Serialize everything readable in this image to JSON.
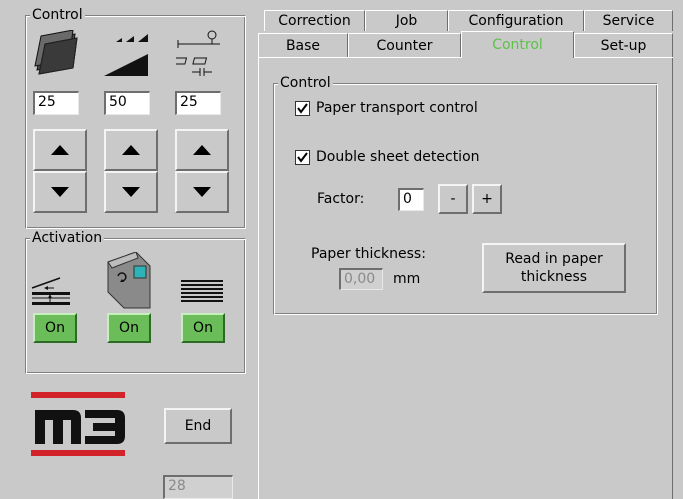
{
  "left_panel": {
    "control_group": {
      "title": "Control",
      "values": [
        "25",
        "50",
        "25"
      ]
    },
    "activation_group": {
      "title": "Activation",
      "buttons": [
        "On",
        "On",
        "On"
      ]
    },
    "logo_text": "M3",
    "end_button": "End",
    "counter_value": "28"
  },
  "tabs": {
    "row_back": [
      "Correction",
      "Job",
      "Configuration",
      "Service"
    ],
    "row_front": [
      "Base",
      "Counter",
      "Control",
      "Set-up"
    ],
    "active": "Control",
    "active_color": "#5cc248"
  },
  "control_panel": {
    "title": "Control",
    "paper_transport": {
      "label": "Paper transport control",
      "checked": true
    },
    "double_sheet": {
      "label": "Double sheet detection",
      "checked": true
    },
    "factor": {
      "label": "Factor:",
      "value": "0",
      "minus": "-",
      "plus": "+"
    },
    "paper_thickness": {
      "label": "Paper thickness:",
      "value": "0,00",
      "unit": "mm",
      "read_button": "Read in paper thickness"
    }
  },
  "colors": {
    "background": "#c9c9c9",
    "on_green": "#6bbd5a",
    "logo_red": "#d2232a"
  }
}
